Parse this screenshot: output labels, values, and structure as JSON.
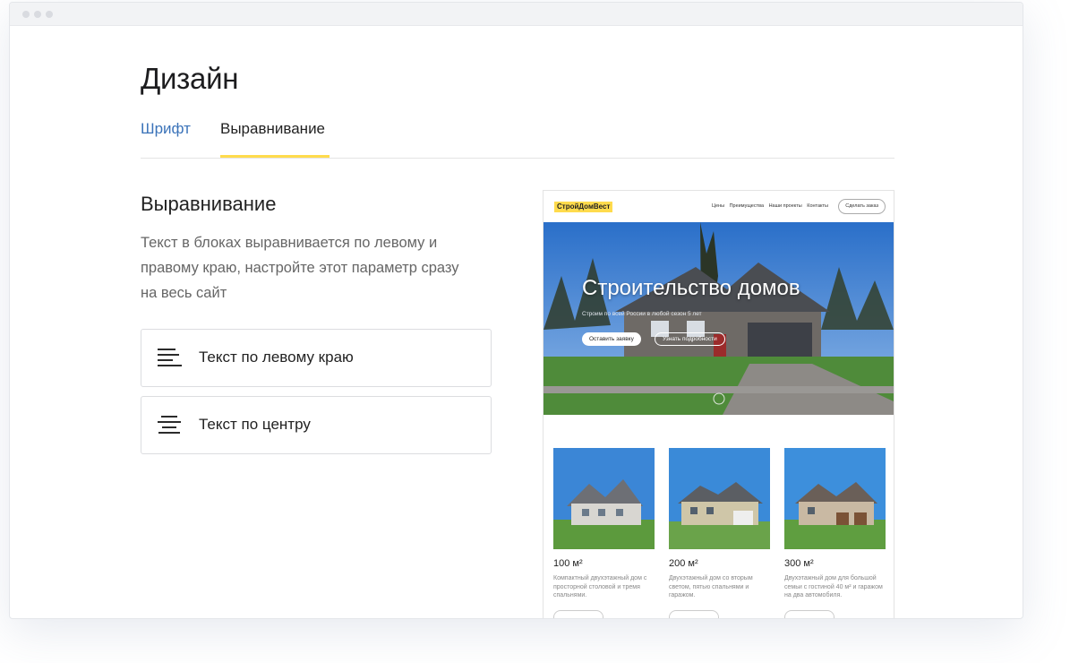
{
  "page": {
    "title": "Дизайн"
  },
  "tabs": [
    {
      "label": "Шрифт",
      "active": false
    },
    {
      "label": "Выравнивание",
      "active": true
    }
  ],
  "section": {
    "title": "Выравнивание",
    "description": "Текст в блоках выравнивается по левому и правому краю, настройте этот параметр сразу на весь сайт"
  },
  "options": [
    {
      "label": "Текст по левому краю",
      "icon": "align-left-icon"
    },
    {
      "label": "Текст по центру",
      "icon": "align-center-icon"
    }
  ],
  "preview": {
    "logo": "СтройДомВест",
    "menu": [
      "Цены",
      "Преимущества",
      "Наши проекты",
      "Контакты"
    ],
    "order_button": "Сделать заказ",
    "hero": {
      "title": "Строительство домов",
      "subtitle": "Строим по всей России в любой сезон 5 лет",
      "primary_button": "Оставить заявку",
      "secondary_button": "Узнать подробности"
    },
    "cards": [
      {
        "area": "100 м²",
        "description": "Компактный двухэтажный дом с просторной столовой и тремя спальнями."
      },
      {
        "area": "200 м²",
        "description": "Двухэтажный дом со вторым светом, пятью спальнями и гаражом."
      },
      {
        "area": "300 м²",
        "description": "Двухэтажный дом для большой семьи с гостиной 40 м² и гаражом на два автомобиля."
      }
    ]
  },
  "colors": {
    "accent_yellow": "#ffdb4d",
    "link_blue": "#3b73b9",
    "text_dark": "#222222",
    "text_muted": "#666666"
  }
}
